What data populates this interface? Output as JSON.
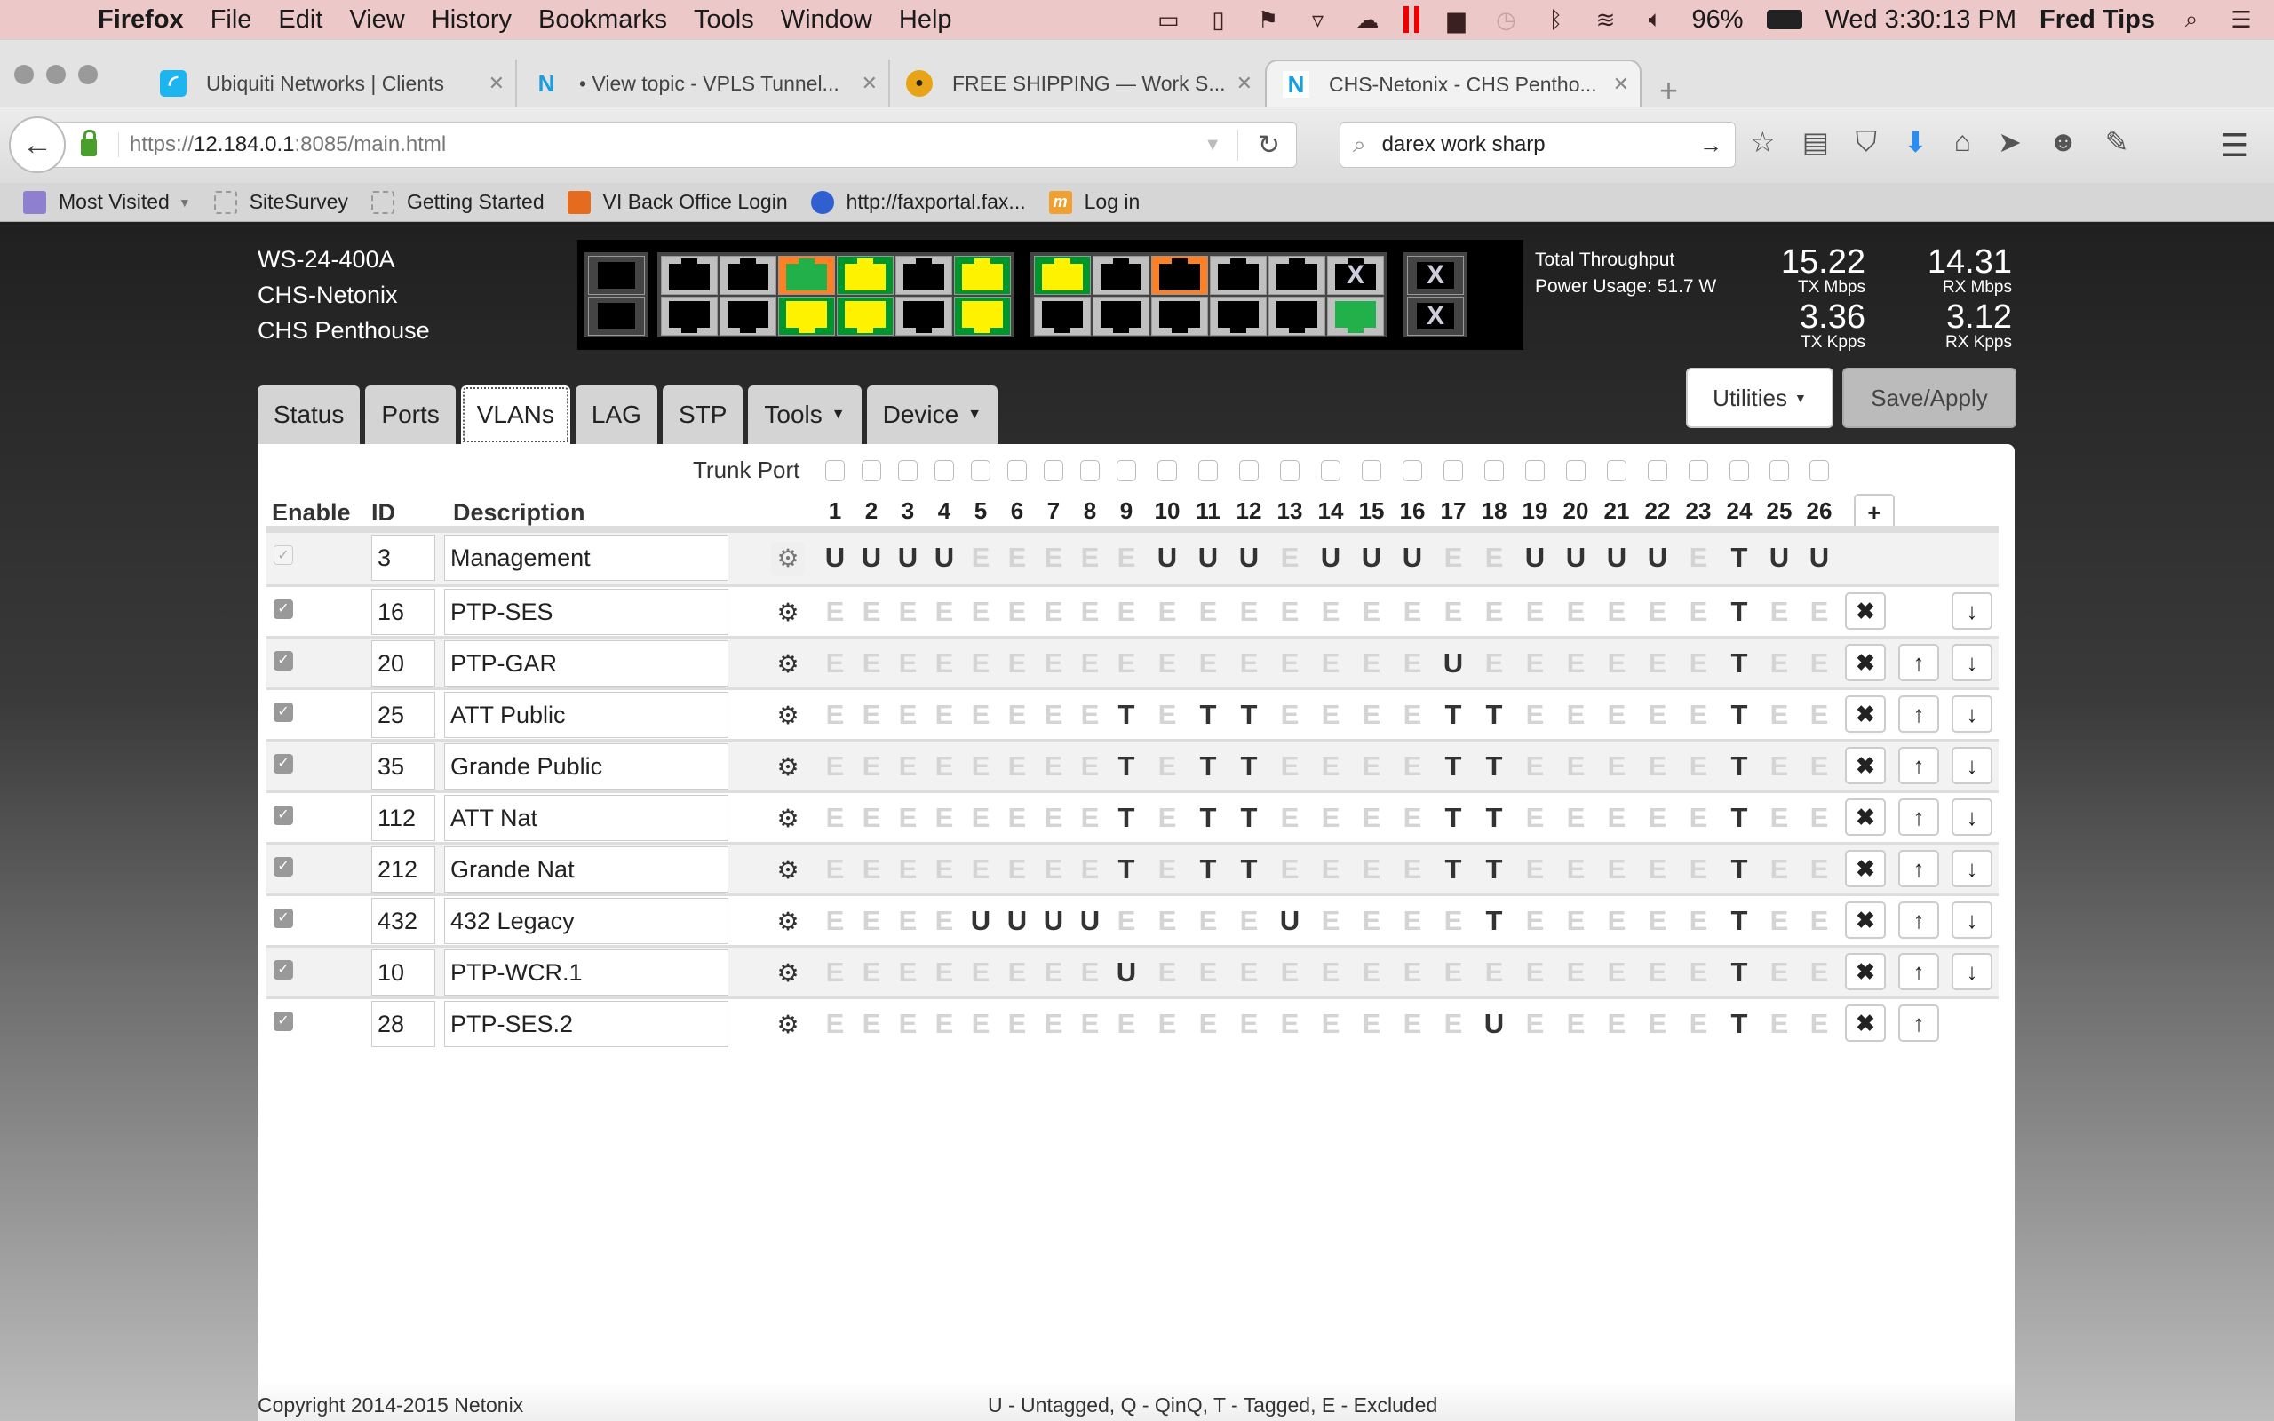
{
  "menubar": {
    "apple": "",
    "app": "Firefox",
    "items": [
      "File",
      "Edit",
      "View",
      "History",
      "Bookmarks",
      "Tools",
      "Window",
      "Help"
    ],
    "battery": "96%",
    "clock": "Wed 3:30:13 PM",
    "user": "Fred Tips"
  },
  "tabs": [
    {
      "title": "Ubiquiti Networks | Clients",
      "icon": "ubiquiti-icon",
      "active": false
    },
    {
      "title": "• View topic - VPLS Tunnel...",
      "icon": "netonix-n-icon",
      "active": false
    },
    {
      "title": "FREE SHIPPING — Work S...",
      "icon": "worksharp-icon",
      "active": false
    },
    {
      "title": "CHS-Netonix - CHS Pentho...",
      "icon": "netonix-n-icon",
      "active": true
    }
  ],
  "navbar": {
    "url_prefix": "https://",
    "url_host": "12.184.0.1",
    "url_rest": ":8085/main.html",
    "search_value": "darex work sharp"
  },
  "bookmarks": [
    {
      "label": "Most Visited",
      "icon": "folder-icon",
      "dropdown": true
    },
    {
      "label": "SiteSurvey",
      "icon": "blank-page-icon"
    },
    {
      "label": "Getting Started",
      "icon": "blank-page-icon"
    },
    {
      "label": "VI Back Office Login",
      "icon": "person-icon"
    },
    {
      "label": "http://faxportal.fax...",
      "icon": "globe-icon"
    },
    {
      "label": "Log in",
      "icon": "m-logo-icon"
    }
  ],
  "device": {
    "model": "WS-24-400A",
    "name": "CHS-Netonix",
    "location": "CHS Penthouse"
  },
  "port_panel": {
    "colors": {
      "link_green": "#00962e",
      "link_orange": "#ff7f24",
      "poe_yellow": "#fff200",
      "idle_gray": "#c0c0c0",
      "active_jack_green": "#22b04a"
    },
    "group1": [
      {
        "port": 1,
        "frame": "gray",
        "jack": "black"
      },
      {
        "port": 2,
        "frame": "gray",
        "jack": "black"
      },
      {
        "port": 3,
        "frame": "gray",
        "jack": "black"
      },
      {
        "port": 4,
        "frame": "gray",
        "jack": "black"
      },
      {
        "port": 5,
        "frame": "orange",
        "jack": "green"
      },
      {
        "port": 6,
        "frame": "green",
        "jack": "yellow"
      },
      {
        "port": 7,
        "frame": "green",
        "jack": "yellow"
      },
      {
        "port": 8,
        "frame": "green",
        "jack": "yellow"
      },
      {
        "port": 9,
        "frame": "gray",
        "jack": "black"
      },
      {
        "port": 10,
        "frame": "gray",
        "jack": "black"
      },
      {
        "port": 11,
        "frame": "green",
        "jack": "yellow"
      },
      {
        "port": 12,
        "frame": "green",
        "jack": "yellow"
      }
    ],
    "group2": [
      {
        "port": 13,
        "frame": "green",
        "jack": "yellow"
      },
      {
        "port": 14,
        "frame": "gray",
        "jack": "black"
      },
      {
        "port": 15,
        "frame": "gray",
        "jack": "black"
      },
      {
        "port": 16,
        "frame": "gray",
        "jack": "black"
      },
      {
        "port": 17,
        "frame": "orange",
        "jack": "black"
      },
      {
        "port": 18,
        "frame": "gray",
        "jack": "black"
      },
      {
        "port": 19,
        "frame": "gray",
        "jack": "black"
      },
      {
        "port": 20,
        "frame": "gray",
        "jack": "black"
      },
      {
        "port": 21,
        "frame": "gray",
        "jack": "black"
      },
      {
        "port": 22,
        "frame": "gray",
        "jack": "black"
      },
      {
        "port": 23,
        "frame": "gray",
        "jack": "x"
      },
      {
        "port": 24,
        "frame": "gray",
        "jack": "green"
      }
    ],
    "sfp": [
      {
        "port": "sfp-a-top",
        "jack": "black"
      },
      {
        "port": "sfp-a-bottom",
        "jack": "black"
      },
      {
        "port": 25,
        "jack": "x"
      },
      {
        "port": 26,
        "jack": "x"
      }
    ],
    "disabled_mark": "X"
  },
  "throughput": {
    "label": "Total Throughput",
    "power": "Power Usage: 51.7 W",
    "tx_mbps": "15.22",
    "tx_mbps_label": "TX Mbps",
    "rx_mbps": "14.31",
    "rx_mbps_label": "RX Mbps",
    "tx_kpps": "3.36",
    "tx_kpps_label": "TX Kpps",
    "rx_kpps": "3.12",
    "rx_kpps_label": "RX Kpps"
  },
  "buttons": {
    "utilities": "Utilities",
    "save_apply": "Save/Apply"
  },
  "nav_tabs": [
    {
      "label": "Status",
      "dropdown": false,
      "active": false
    },
    {
      "label": "Ports",
      "dropdown": false,
      "active": false
    },
    {
      "label": "VLANs",
      "dropdown": false,
      "active": true
    },
    {
      "label": "LAG",
      "dropdown": false,
      "active": false
    },
    {
      "label": "STP",
      "dropdown": false,
      "active": false
    },
    {
      "label": "Tools",
      "dropdown": true,
      "active": false
    },
    {
      "label": "Device",
      "dropdown": true,
      "active": false
    }
  ],
  "vlan_table": {
    "trunk_label": "Trunk Port",
    "headers": {
      "enable": "Enable",
      "id": "ID",
      "description": "Description"
    },
    "ports": [
      "1",
      "2",
      "3",
      "4",
      "5",
      "6",
      "7",
      "8",
      "9",
      "10",
      "11",
      "12",
      "13",
      "14",
      "15",
      "16",
      "17",
      "18",
      "19",
      "20",
      "21",
      "22",
      "23",
      "24",
      "25",
      "26"
    ],
    "trunk_checked": [
      false,
      false,
      false,
      false,
      false,
      false,
      false,
      false,
      false,
      false,
      false,
      false,
      false,
      false,
      false,
      false,
      false,
      false,
      false,
      false,
      false,
      false,
      false,
      false,
      false,
      false
    ],
    "add_label": "+",
    "rows": [
      {
        "enabled": true,
        "locked": true,
        "id": "3",
        "description": "Management",
        "members": "UUUUEEEEEUUUEUUUEEUUUUETUU",
        "delete": false,
        "up": false,
        "down": false
      },
      {
        "enabled": true,
        "id": "16",
        "description": "PTP-SES",
        "members": "EEEEEEEEEEEEEEEEEEEEEEETEE",
        "delete": true,
        "up": false,
        "down": true
      },
      {
        "enabled": true,
        "id": "20",
        "description": "PTP-GAR",
        "members": "EEEEEEEEEEEEEEEEUEEEEEETEE",
        "delete": true,
        "up": true,
        "down": true
      },
      {
        "enabled": true,
        "id": "25",
        "description": "ATT Public",
        "members": "EEEEEEEETETTEEEETTEEEEETEE",
        "delete": true,
        "up": true,
        "down": true
      },
      {
        "enabled": true,
        "id": "35",
        "description": "Grande Public",
        "members": "EEEEEEEETETTEEEETTEEEEETEE",
        "delete": true,
        "up": true,
        "down": true
      },
      {
        "enabled": true,
        "id": "112",
        "description": "ATT Nat",
        "members": "EEEEEEEETETTEEEETTEEEEETEE",
        "delete": true,
        "up": true,
        "down": true
      },
      {
        "enabled": true,
        "id": "212",
        "description": "Grande Nat",
        "members": "EEEEEEEETETTEEEETTEEEEETEE",
        "delete": true,
        "up": true,
        "down": true
      },
      {
        "enabled": true,
        "id": "432",
        "description": "432 Legacy",
        "members": "EEEEUUUUEEEEUEEEETEEEEETEE",
        "delete": true,
        "up": true,
        "down": true
      },
      {
        "enabled": true,
        "id": "10",
        "description": "PTP-WCR.1",
        "members": "EEEEEEEEUEEEEEEEEEEEEEETEE",
        "delete": true,
        "up": true,
        "down": true
      },
      {
        "enabled": true,
        "id": "28",
        "description": "PTP-SES.2",
        "members": "EEEEEEEEEEEEEEEEEUEEEEETEE",
        "delete": true,
        "up": true,
        "down": false
      }
    ]
  },
  "footer": {
    "copyright": "Copyright 2014-2015 Netonix",
    "legend": "U - Untagged, Q - QinQ, T - Tagged, E - Excluded"
  }
}
